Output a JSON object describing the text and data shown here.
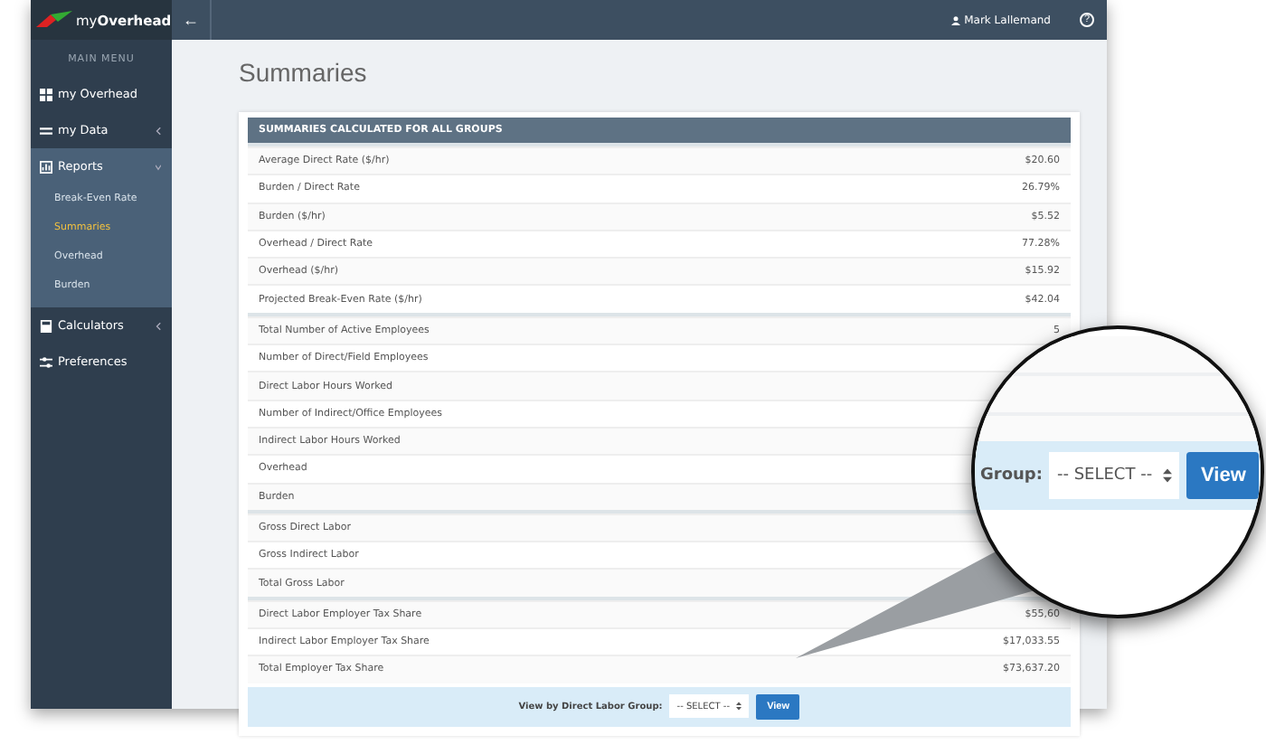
{
  "logo": {
    "text": "my**Overhead**"
  },
  "topbar": {
    "back": "←",
    "user": "Mark Lallemand",
    "help": "?"
  },
  "sidebar": {
    "heading": "MAIN MENU",
    "items": [
      {
        "label": "my Overhead",
        "kind": "link"
      },
      {
        "label": "my Data",
        "kind": "group",
        "expanded": false
      },
      {
        "label": "Reports",
        "kind": "group",
        "expanded": true,
        "children": [
          {
            "label": "Break-Even Rate",
            "selected": false
          },
          {
            "label": "Summaries",
            "selected": true
          },
          {
            "label": "Overhead",
            "selected": false
          },
          {
            "label": "Burden",
            "selected": false
          }
        ]
      },
      {
        "label": "Calculators",
        "kind": "group",
        "expanded": false
      },
      {
        "label": "Preferences",
        "kind": "link"
      }
    ]
  },
  "page_title": "Summaries",
  "table": {
    "title": "SUMMARIES CALCULATED FOR ALL GROUPS",
    "groups": [
      [
        {
          "label": "Average Direct Rate ($/hr)",
          "value": "$20.60"
        },
        {
          "label": "Burden / Direct Rate",
          "value": "26.79%"
        },
        {
          "label": "Burden ($/hr)",
          "value": "$5.52"
        },
        {
          "label": "Overhead / Direct Rate",
          "value": "77.28%"
        },
        {
          "label": "Overhead ($/hr)",
          "value": "$15.92"
        },
        {
          "label": "Projected Break-Even Rate ($/hr)",
          "value": "$42.04"
        }
      ],
      [
        {
          "label": "Total Number of Active Employees",
          "value": "5"
        },
        {
          "label": "Number of Direct/Field Employees"
        },
        {
          "label": "Direct Labor Hours Worked"
        },
        {
          "label": "Number of Indirect/Office Employees"
        },
        {
          "label": "Indirect Labor Hours Worked"
        },
        {
          "label": "Overhead"
        },
        {
          "label": "Burden"
        }
      ],
      [
        {
          "label": "Gross Direct Labor"
        },
        {
          "label": "Gross Indirect Labor"
        },
        {
          "label": "Total Gross Labor"
        }
      ],
      [
        {
          "label": "Direct Labor Employer Tax Share",
          "value": "$55,60"
        },
        {
          "label": "Indirect Labor Employer Tax Share",
          "value": "$17,033.55"
        },
        {
          "label": "Total Employer Tax Share",
          "value": "$73,637.20"
        }
      ]
    ],
    "footer": {
      "label": "View by Direct Labor Group:",
      "select": "-- SELECT --",
      "button": "View"
    }
  },
  "magnifier": {
    "label": "Group:",
    "select": "-- SELECT --",
    "button": "View"
  }
}
